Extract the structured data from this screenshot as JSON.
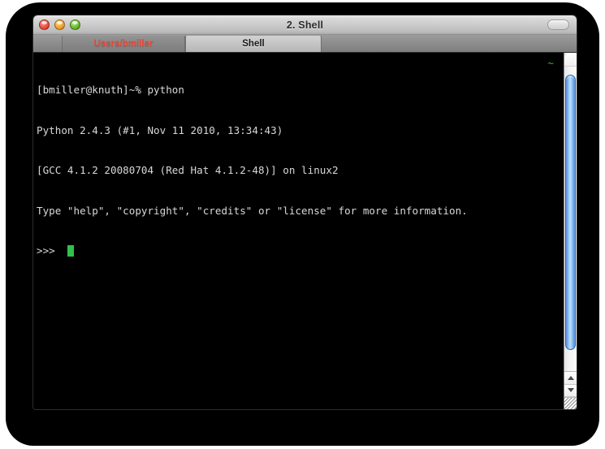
{
  "window": {
    "title": "2. Shell",
    "controls": {
      "close_label": "close",
      "minimize_label": "minimize",
      "zoom_label": "zoom"
    },
    "toolbar_toggle_label": ""
  },
  "tabs": [
    {
      "label": "Users/bmiller",
      "active": false,
      "color": "#f4432e"
    },
    {
      "label": "Shell",
      "active": true,
      "color": "#1a1a1a"
    }
  ],
  "terminal": {
    "home_marker": "~",
    "lines": [
      "[bmiller@knuth]~% python",
      "Python 2.4.3 (#1, Nov 11 2010, 13:34:43)",
      "[GCC 4.1.2 20080704 (Red Hat 4.1.2-48)] on linux2",
      "Type \"help\", \"copyright\", \"credits\" or \"license\" for more information."
    ],
    "prompt": ">>>",
    "cursor_color": "#2fc14a",
    "text_color": "#d8d8d8",
    "background_color": "#000000"
  },
  "scrollbar": {
    "thumb_color": "#7fb6f2",
    "up_arrow_label": "scroll up",
    "down_arrow_label": "scroll down",
    "resize_label": "resize window"
  }
}
